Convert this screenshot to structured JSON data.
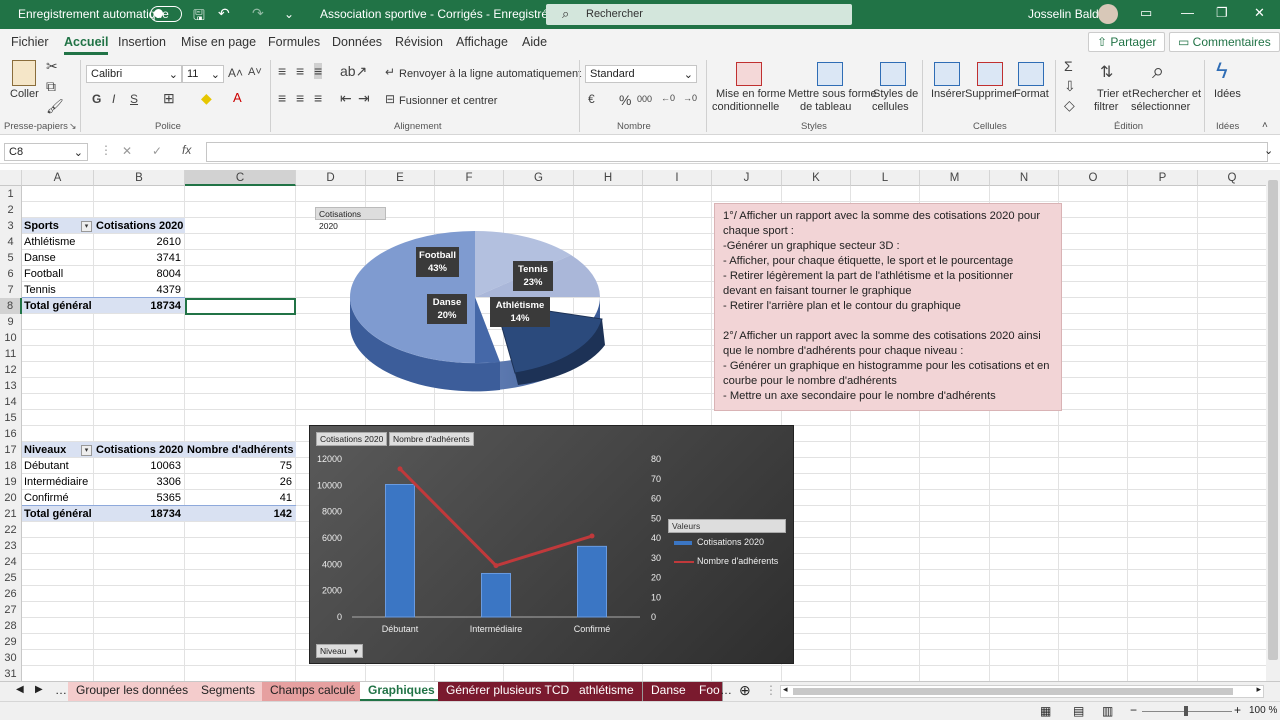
{
  "titlebar": {
    "autosave": "Enregistrement automatique",
    "doc_title": "Association sportive - Corrigés  -  Enregistré  ▾",
    "search_placeholder": "Rechercher",
    "user": "Josselin Baldé"
  },
  "menu": {
    "items": [
      "Fichier",
      "Accueil",
      "Insertion",
      "Mise en page",
      "Formules",
      "Données",
      "Révision",
      "Affichage",
      "Aide"
    ],
    "share": "Partager",
    "comments": "Commentaires"
  },
  "ribbon": {
    "coller": "Coller",
    "presse": "Presse-papiers",
    "font": "Calibri",
    "size": "11",
    "police": "Police",
    "wrap": "Renvoyer à la ligne automatiquement",
    "merge": "Fusionner et centrer",
    "alignement": "Alignement",
    "format": "Standard",
    "nombre": "Nombre",
    "mfc1": "Mise en forme",
    "mfc2": "conditionnelle",
    "msf1": "Mettre sous forme",
    "msf2": "de tableau",
    "sty1": "Styles de",
    "sty2": "cellules",
    "styles": "Styles",
    "insert": "Insérer",
    "delete": "Supprimer",
    "formatbtn": "Format",
    "cellules": "Cellules",
    "trier1": "Trier et",
    "trier2": "filtrer",
    "rech1": "Rechercher et",
    "rech2": "sélectionner",
    "edition": "Édition",
    "idees": "Idées"
  },
  "namebox": "C8",
  "columns": [
    "A",
    "B",
    "C",
    "D",
    "E",
    "F",
    "G",
    "H",
    "I",
    "J",
    "K",
    "L",
    "M",
    "N",
    "O",
    "P",
    "Q"
  ],
  "rows": [
    "1",
    "2",
    "3",
    "4",
    "5",
    "6",
    "7",
    "8",
    "9",
    "10",
    "11",
    "12",
    "13",
    "14",
    "15",
    "16",
    "17",
    "18",
    "19",
    "20",
    "21",
    "22",
    "23",
    "24",
    "25",
    "26",
    "27",
    "28",
    "29",
    "30",
    "31"
  ],
  "table1": {
    "h1": "Sports",
    "h2": "Cotisations 2020",
    "rows": [
      [
        "Athlétisme",
        "2610"
      ],
      [
        "Danse",
        "3741"
      ],
      [
        "Football",
        "8004"
      ],
      [
        "Tennis",
        "4379"
      ]
    ],
    "total": [
      "Total général",
      "18734"
    ]
  },
  "table2": {
    "h1": "Niveaux",
    "h2": "Cotisations 2020",
    "h3": "Nombre d'adhérents",
    "rows": [
      [
        "Débutant",
        "10063",
        "75"
      ],
      [
        "Intermédiaire",
        "3306",
        "26"
      ],
      [
        "Confirmé",
        "5365",
        "41"
      ]
    ],
    "total": [
      "Total général",
      "18734",
      "142"
    ]
  },
  "note": "1°/ Afficher un rapport avec la somme des cotisations 2020 pour\nchaque sport :\n-Générer un graphique secteur 3D :\n- Afficher, pour chaque étiquette, le sport et le pourcentage\n- Retirer légèrement la part de l'athlétisme et la positionner\ndevant en faisant tourner le graphique\n- Retirer l'arrière plan et le contour du graphique\n\n2°/ Afficher un rapport avec la somme des cotisations 2020 ainsi\nque le nombre d'adhérents pour chaque niveau :\n- Générer un graphique en histogramme pour les cotisations et en\ncourbe pour le nombre d'adhérents\n- Mettre un axe secondaire pour le nombre d'adhérents",
  "chart_data": [
    {
      "type": "pie",
      "field_button": "Cotisations 2020",
      "categories": [
        "Football",
        "Tennis",
        "Athlétisme",
        "Danse"
      ],
      "values": [
        8004,
        4379,
        2610,
        3741
      ],
      "labels": [
        "43%",
        "23%",
        "14%",
        "20%"
      ],
      "colors": [
        "#7f9bd0",
        "#b3c0df",
        "#2b4a7c",
        "#4568a8"
      ]
    },
    {
      "type": "bar",
      "field_buttons": [
        "Cotisations 2020",
        "Nombre d'adhérents"
      ],
      "axis_button": "Niveau",
      "categories": [
        "Débutant",
        "Intermédiaire",
        "Confirmé"
      ],
      "series": [
        {
          "name": "Cotisations 2020",
          "type": "bar",
          "values": [
            10063,
            3306,
            5365
          ],
          "color": "#3b76c4"
        },
        {
          "name": "Nombre d'adhérents",
          "type": "line",
          "axis": "secondary",
          "values": [
            75,
            26,
            41
          ],
          "color": "#c0393b"
        }
      ],
      "y_ticks": [
        "12000",
        "10000",
        "8000",
        "6000",
        "4000",
        "2000",
        "0"
      ],
      "y2_ticks": [
        "80",
        "70",
        "60",
        "50",
        "40",
        "30",
        "20",
        "10",
        "0"
      ],
      "ylim": [
        0,
        12000
      ],
      "y2lim": [
        0,
        80
      ],
      "legend_title": "Valeurs",
      "legend": "right"
    }
  ],
  "sheet_tabs": [
    "…",
    "Grouper les données",
    "Segments",
    "Champs calculé",
    "Graphiques",
    "Générer plusieurs TCD",
    "athlétisme",
    "Danse",
    "Foo"
  ],
  "zoom": "100 %"
}
